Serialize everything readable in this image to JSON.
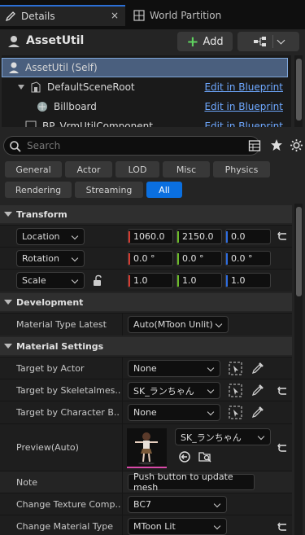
{
  "tabs": [
    {
      "label": "Details",
      "icon": "pencil-icon"
    },
    {
      "label": "World Partition",
      "icon": "grid-icon"
    }
  ],
  "tab_close": "×",
  "header": {
    "title": "AssetUtil",
    "add_label": "Add",
    "add_glyph": "+"
  },
  "components": [
    {
      "label": "AssetUtil (Self)",
      "link": ""
    },
    {
      "label": "DefaultSceneRoot",
      "link": "Edit in Blueprint"
    },
    {
      "label": "Billboard",
      "link": "Edit in Blueprint"
    },
    {
      "label": "BP_VrmUtilComponent",
      "link": "Edit in Blueprint"
    }
  ],
  "search": {
    "placeholder": "Search"
  },
  "filters": [
    "General",
    "Actor",
    "LOD",
    "Misc",
    "Physics",
    "Rendering",
    "Streaming",
    "All"
  ],
  "active_filter": "All",
  "transform": {
    "title": "Transform",
    "rows": [
      {
        "label": "Location",
        "values": [
          "1060.0",
          "2150.0",
          "0.0"
        ]
      },
      {
        "label": "Rotation",
        "values": [
          "0.0 °",
          "0.0 °",
          "0.0 °"
        ]
      },
      {
        "label": "Scale",
        "values": [
          "1.0",
          "1.0",
          "1.0"
        ]
      }
    ]
  },
  "development": {
    "title": "Development",
    "rows": [
      {
        "label": "Material Type Latest",
        "value": "Auto(MToon Unlit)"
      }
    ]
  },
  "material": {
    "title": "Material Settings",
    "rows": [
      {
        "label": "Target by Actor",
        "value": "None"
      },
      {
        "label": "Target by Skeletalmes...",
        "value": "SK_ランちゃん"
      },
      {
        "label": "Target by Character B...",
        "value": "None"
      }
    ],
    "preview_label": "Preview(Auto)",
    "preview_value": "SK_ランちゃん",
    "note_label": "Note",
    "note_value": "Push button to update mesh",
    "texture_label": "Change Texture Comp...",
    "texture_value": "BC7",
    "mattype_label": "Change Material Type",
    "mattype_value": "MToon Lit"
  },
  "colors": {
    "accent": "#0a6fe0",
    "x_axis": "#d63a2f",
    "y_axis": "#6dbb2a",
    "z_axis": "#2f6de0",
    "link": "#6ea8ff"
  }
}
